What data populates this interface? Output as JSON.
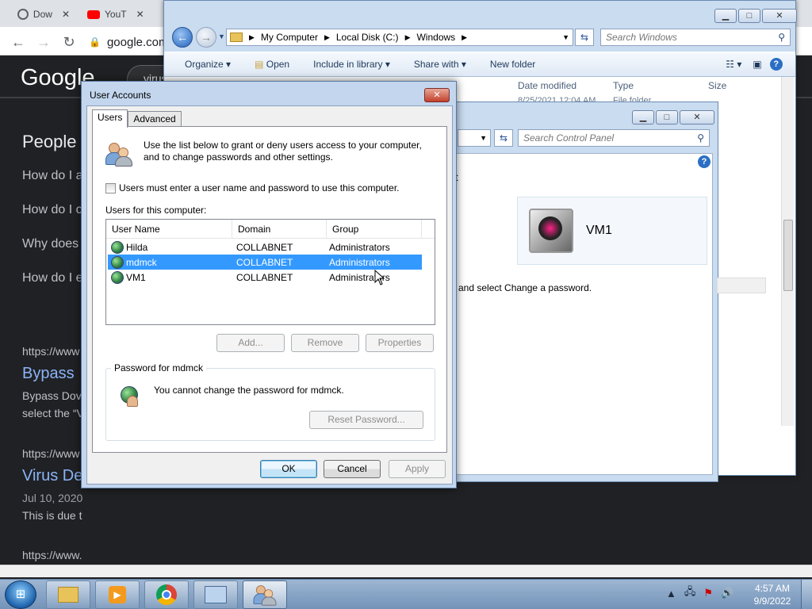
{
  "browser": {
    "tabs": [
      {
        "label": "Dow"
      },
      {
        "label": "YouT"
      }
    ],
    "url": "google.com",
    "logo": "Google",
    "search_fragment": "virus",
    "people_heading": "People",
    "paa": [
      "How do I a",
      "How do I c",
      "Why does",
      "How do I e"
    ],
    "results": [
      {
        "cite": "https://www",
        "title": "Bypass",
        "snippet1_bold": "Bypass Dov",
        "snippet2": "select the “V"
      },
      {
        "cite": "https://www",
        "title": "Virus De",
        "date": "Jul 10, 2020",
        "snippet": "This is due t"
      }
    ],
    "last_cite": "https://www."
  },
  "explorer": {
    "breadcrumbs": [
      "My Computer",
      "Local Disk (C:)",
      "Windows"
    ],
    "search_placeholder": "Search Windows",
    "commands": [
      "Organize",
      "Open",
      "Include in library",
      "Share with",
      "New folder"
    ],
    "columns": [
      "Date modified",
      "Type",
      "Size"
    ],
    "partial_row": {
      "date": "8/25/2021 12:04 AM",
      "type": "File folder"
    }
  },
  "control_panel": {
    "search_placeholder": "Search Control Panel",
    "fragment_t": "t",
    "user_name": "VM1",
    "hint": "and select Change a password."
  },
  "user_accounts": {
    "title": "User Accounts",
    "tabs": [
      "Users",
      "Advanced"
    ],
    "intro": "Use the list below to grant or deny users access to your computer, and to change passwords and other settings.",
    "must_enter_label": "Users must enter a user name and password to use this computer.",
    "users_label": "Users for this computer:",
    "columns": [
      "User Name",
      "Domain",
      "Group"
    ],
    "rows": [
      {
        "name": "Hilda",
        "domain": "COLLABNET",
        "group": "Administrators"
      },
      {
        "name": "mdmck",
        "domain": "COLLABNET",
        "group": "Administrators"
      },
      {
        "name": "VM1",
        "domain": "COLLABNET",
        "group": "Administrators"
      }
    ],
    "selected_row": 1,
    "buttons": {
      "add": "Add...",
      "remove": "Remove",
      "properties": "Properties"
    },
    "password_group": "Password for mdmck",
    "password_msg": "You cannot change the password for mdmck.",
    "reset_password": "Reset Password...",
    "ok": "OK",
    "cancel": "Cancel",
    "apply": "Apply"
  },
  "taskbar": {
    "time": "4:57 AM",
    "date": "9/9/2022",
    "buttons": [
      "explorer-icon",
      "media-player-icon",
      "chrome-icon",
      "control-panel-icon",
      "user-accounts-icon"
    ]
  },
  "colors": {
    "selection": "#3399ff",
    "google_link": "#8ab4f8",
    "aero_frame": "#c9dcf0"
  }
}
